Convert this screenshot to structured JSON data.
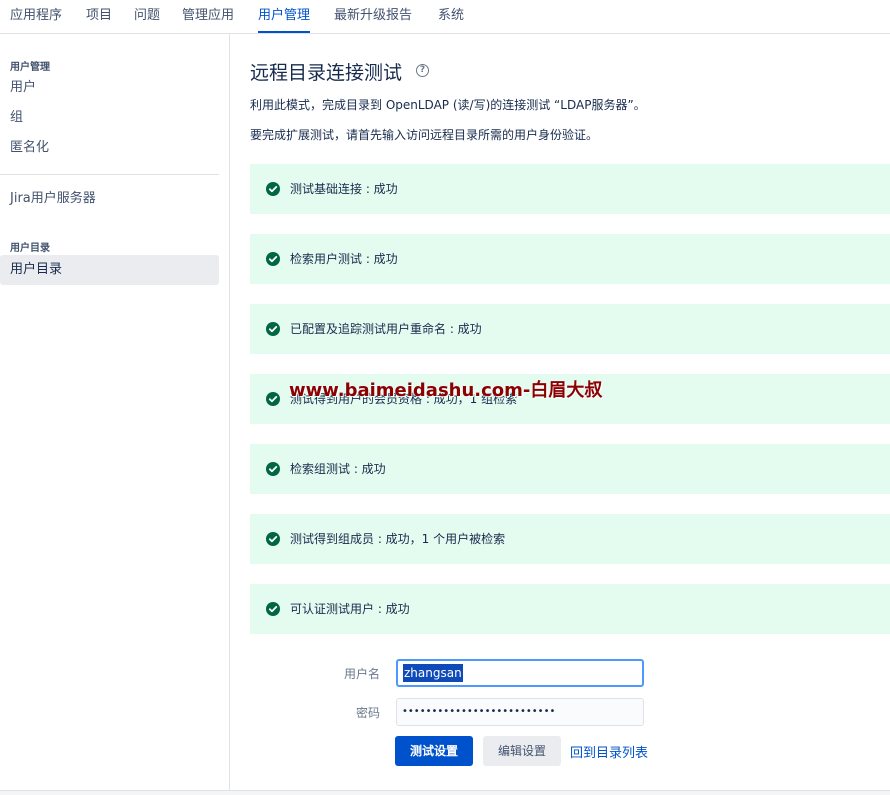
{
  "topnav": {
    "tabs": [
      {
        "label": "应用程序"
      },
      {
        "label": "项目"
      },
      {
        "label": "问题"
      },
      {
        "label": "管理应用"
      },
      {
        "label": "用户管理"
      },
      {
        "label": "最新升级报告"
      },
      {
        "label": "系统"
      }
    ],
    "active_tab": "用户管理"
  },
  "sidebar": {
    "section1_heading": "用户管理",
    "items": [
      {
        "label": "用户"
      },
      {
        "label": "组"
      },
      {
        "label": "匿名化"
      },
      {
        "label": "Jira用户服务器"
      },
      {
        "label": "用户目录"
      }
    ],
    "section2_heading": "用户目录",
    "active_item": "用户目录"
  },
  "main": {
    "title": "远程目录连接测试",
    "help_icon": "?",
    "description1": "利用此模式，完成目录到 OpenLDAP (读/写)的连接测试 “LDAP服务器”。",
    "description2": "要完成扩展测试，请首先输入访问远程目录所需的用户身份验证。",
    "results": [
      {
        "text": "测试基础连接 : 成功"
      },
      {
        "text": "检索用户测试 : 成功"
      },
      {
        "text": "已配置及追踪测试用户重命名 : 成功"
      },
      {
        "text": "测试得到用户的会员资格 : 成功，1 组检索"
      },
      {
        "text": "检索组测试 : 成功"
      },
      {
        "text": "测试得到组成员 : 成功，1 个用户被检索"
      },
      {
        "text": "可认证测试用户 : 成功"
      }
    ],
    "status_icon": "check-circle-icon",
    "form": {
      "username_label": "用户名",
      "username_value": "zhangsan",
      "password_label": "密码",
      "password_value": "••••••••••••••••••••••••••",
      "test_button": "测试设置",
      "edit_button": "编辑设置",
      "back_link": "回到目录列表"
    }
  },
  "watermark": "www.baimeidashu.com-白眉大叔",
  "colors": {
    "accent": "#0052cc",
    "success_bg": "#e3fcef",
    "success_icon": "#006644",
    "watermark": "#8b0000"
  }
}
